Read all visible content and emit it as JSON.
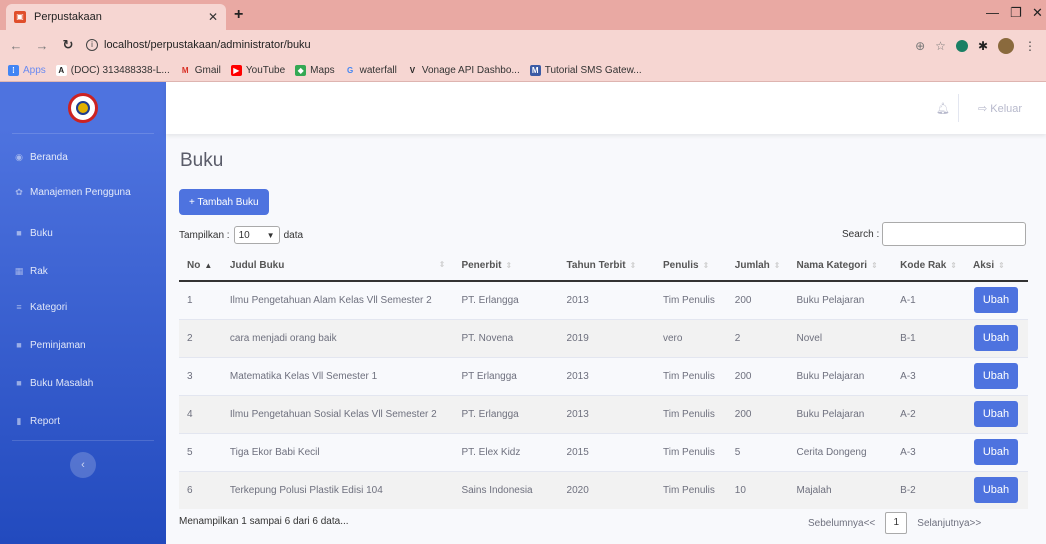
{
  "browser": {
    "tab_title": "Perpustakaan",
    "url": "localhost/perpustakaan/administrator/buku",
    "bookmarks": [
      {
        "label": "Apps",
        "icon": "apps-grid-icon"
      },
      {
        "label": "(DOC) 313488338-L...",
        "icon": "academia-icon"
      },
      {
        "label": "Gmail",
        "icon": "gmail-icon"
      },
      {
        "label": "YouTube",
        "icon": "youtube-icon"
      },
      {
        "label": "Maps",
        "icon": "maps-icon"
      },
      {
        "label": "waterfall",
        "icon": "google-icon"
      },
      {
        "label": "Vonage API Dashbo...",
        "icon": "vonage-icon"
      },
      {
        "label": "Tutorial SMS Gatew...",
        "icon": "tutorial-icon"
      }
    ]
  },
  "sidebar": {
    "items": [
      {
        "label": "Beranda",
        "icon": "dashboard-icon"
      },
      {
        "label": "Manajemen Pengguna",
        "icon": "users-icon"
      },
      {
        "label": "Buku",
        "icon": "book-icon"
      },
      {
        "label": "Rak",
        "icon": "shelf-icon"
      },
      {
        "label": "Kategori",
        "icon": "list-icon"
      },
      {
        "label": "Peminjaman",
        "icon": "loan-icon"
      },
      {
        "label": "Buku Masalah",
        "icon": "book-problem-icon"
      },
      {
        "label": "Report",
        "icon": "report-icon"
      }
    ]
  },
  "topbar": {
    "logout_label": "Keluar"
  },
  "main": {
    "title": "Buku",
    "add_button": "+ Tambah Buku",
    "length_prefix": "Tampilkan :",
    "length_value": "10",
    "length_suffix": "data",
    "search_label": "Search :",
    "columns": [
      "No",
      "Judul Buku",
      "Penerbit",
      "Tahun Terbit",
      "Penulis",
      "Jumlah",
      "Nama Kategori",
      "Kode Rak",
      "Aksi"
    ],
    "rows": [
      {
        "no": "1",
        "judul": "Ilmu Pengetahuan Alam Kelas Vll Semester 2",
        "penerbit": "PT. Erlangga",
        "tahun": "2013",
        "penulis": "Tim Penulis",
        "jumlah": "200",
        "kategori": "Buku Pelajaran",
        "rak": "A-1",
        "aksi": "Ubah"
      },
      {
        "no": "2",
        "judul": "cara menjadi orang baik",
        "penerbit": "PT. Novena",
        "tahun": "2019",
        "penulis": "vero",
        "jumlah": "2",
        "kategori": "Novel",
        "rak": "B-1",
        "aksi": "Ubah"
      },
      {
        "no": "3",
        "judul": "Matematika Kelas Vll Semester 1",
        "penerbit": "PT Erlangga",
        "tahun": "2013",
        "penulis": "Tim Penulis",
        "jumlah": "200",
        "kategori": "Buku Pelajaran",
        "rak": "A-3",
        "aksi": "Ubah"
      },
      {
        "no": "4",
        "judul": "Ilmu Pengetahuan Sosial Kelas Vll Semester 2",
        "penerbit": "PT. Erlangga",
        "tahun": "2013",
        "penulis": "Tim Penulis",
        "jumlah": "200",
        "kategori": "Buku Pelajaran",
        "rak": "A-2",
        "aksi": "Ubah"
      },
      {
        "no": "5",
        "judul": "Tiga Ekor Babi Kecil",
        "penerbit": "PT. Elex Kidz",
        "tahun": "2015",
        "penulis": "Tim Penulis",
        "jumlah": "5",
        "kategori": "Cerita Dongeng",
        "rak": "A-3",
        "aksi": "Ubah"
      },
      {
        "no": "6",
        "judul": "Terkepung Polusi Plastik Edisi 104",
        "penerbit": "Sains Indonesia",
        "tahun": "2020",
        "penulis": "Tim Penulis",
        "jumlah": "10",
        "kategori": "Majalah",
        "rak": "B-2",
        "aksi": "Ubah"
      }
    ],
    "info": "Menampilkan 1 sampai 6 dari 6 data...",
    "pager": {
      "prev": "Sebelumnya<<",
      "current": "1",
      "next": "Selanjutnya>>"
    }
  },
  "colors": {
    "primary": "#4e73df",
    "sidebar_dark": "#224abe",
    "browser_chrome": "#f6d6d2"
  }
}
